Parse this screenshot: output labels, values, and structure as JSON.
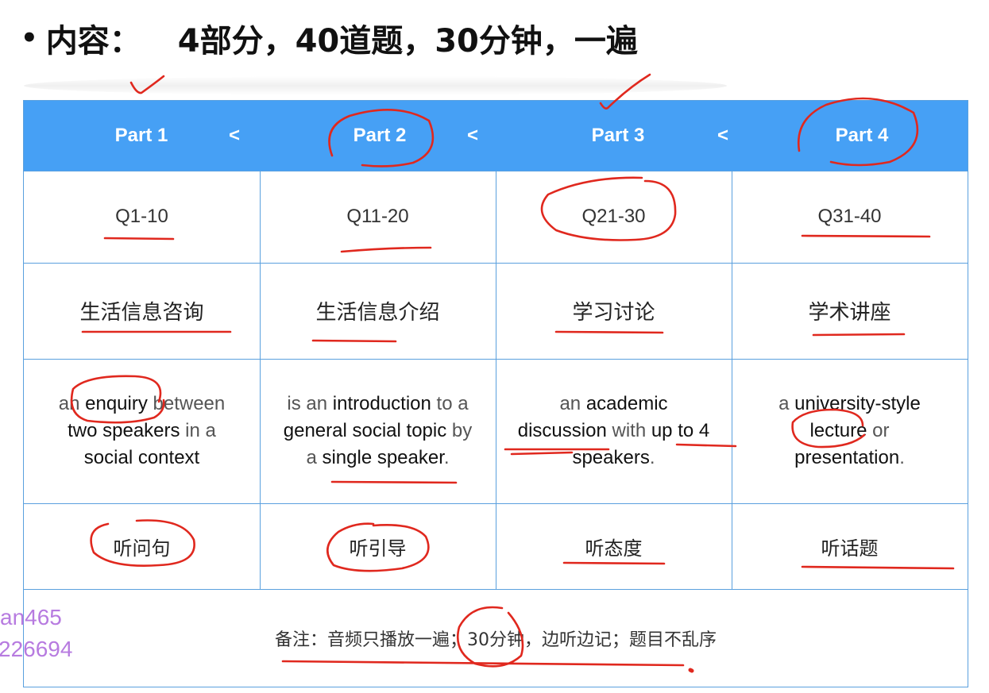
{
  "heading": {
    "bullet": "•",
    "label": "内容：",
    "summary": "4部分，40道题，30分钟，一遍"
  },
  "header": {
    "parts": [
      "Part 1",
      "Part 2",
      "Part 3",
      "Part 4"
    ],
    "separator": "<"
  },
  "rows": {
    "questions": [
      "Q1-10",
      "Q11-20",
      "Q21-30",
      "Q31-40"
    ],
    "topics": [
      "生活信息咨询",
      "生活信息介绍",
      "学习讨论",
      "学术讲座"
    ],
    "descriptions": [
      [
        {
          "t": "an ",
          "k": false
        },
        {
          "t": "enquiry",
          "k": true
        },
        {
          "t": " between",
          "k": false
        },
        {
          "br": true
        },
        {
          "t": "two speakers",
          "k": true
        },
        {
          "t": " in a",
          "k": false
        },
        {
          "br": true
        },
        {
          "t": "social context",
          "k": true
        }
      ],
      [
        {
          "t": "is an ",
          "k": false
        },
        {
          "t": "introduction",
          "k": true
        },
        {
          "t": " to a",
          "k": false
        },
        {
          "br": true
        },
        {
          "t": "general social topic",
          "k": true
        },
        {
          "t": " by",
          "k": false
        },
        {
          "br": true
        },
        {
          "t": "a ",
          "k": false
        },
        {
          "t": "single speaker",
          "k": true
        },
        {
          "t": ".",
          "k": false
        }
      ],
      [
        {
          "t": "an ",
          "k": false
        },
        {
          "t": "academic",
          "k": true
        },
        {
          "br": true
        },
        {
          "t": "discussion",
          "k": true
        },
        {
          "t": " with ",
          "k": false
        },
        {
          "t": "up to 4",
          "k": true
        },
        {
          "br": true
        },
        {
          "t": "speakers",
          "k": true
        },
        {
          "t": ".",
          "k": false
        }
      ],
      [
        {
          "t": "a ",
          "k": false
        },
        {
          "t": "university-style",
          "k": true
        },
        {
          "br": true
        },
        {
          "t": "lecture",
          "k": true
        },
        {
          "t": " or",
          "k": false
        },
        {
          "br": true
        },
        {
          "t": "presentation",
          "k": true
        },
        {
          "t": ".",
          "k": false
        }
      ]
    ],
    "focus": [
      "听问句",
      "听引导",
      "听态度",
      "听话题"
    ]
  },
  "note": "备注：音频只播放一遍；30分钟，边听边记；题目不乱序",
  "watermark": {
    "line1": "an465",
    "line2": "226694"
  },
  "colors": {
    "header_bg": "#46a0f5",
    "border": "#5aa0de",
    "annotation_ink": "#e0281e",
    "watermark": "#b77be0"
  }
}
